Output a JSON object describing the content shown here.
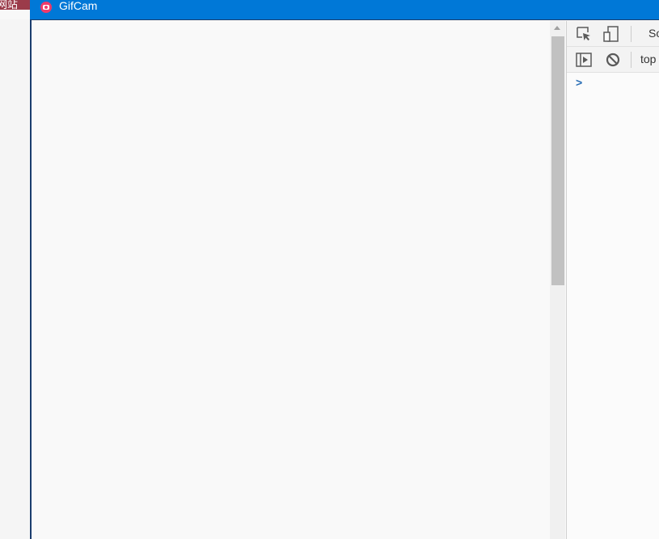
{
  "background": {
    "tab_label": "网站"
  },
  "titlebar": {
    "app_icon": "gifcam-icon",
    "title": "GifCam"
  },
  "scrollbar": {
    "up_icon": "scroll-up-arrow-icon",
    "scroll_fraction_visible": 0.49
  },
  "devtools": {
    "toolbar_row1": {
      "inspect_icon": "inspect-element-icon",
      "device_icon": "device-toolbar-icon",
      "tab_label_partial": "So"
    },
    "toolbar_row2": {
      "sidebar_icon": "show-sidebar-icon",
      "clear_icon": "clear-console-icon",
      "context_label": "top"
    },
    "console": {
      "prompt": ">"
    }
  }
}
